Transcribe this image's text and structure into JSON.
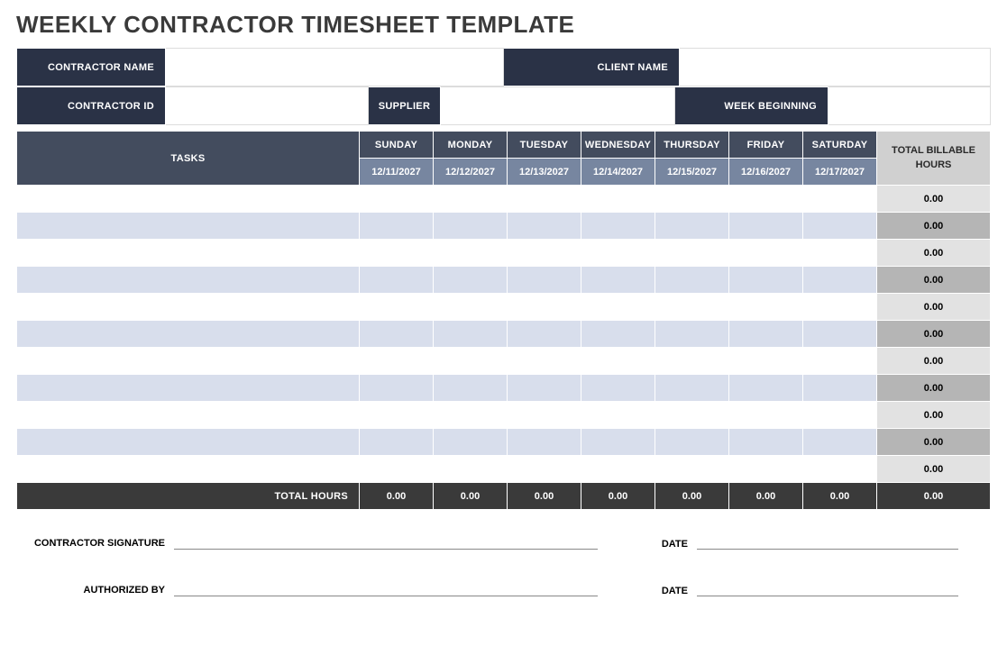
{
  "title": "WEEKLY CONTRACTOR TIMESHEET TEMPLATE",
  "meta": {
    "contractor_name_label": "CONTRACTOR NAME",
    "contractor_name": "",
    "client_name_label": "CLIENT NAME",
    "client_name": "",
    "contractor_id_label": "CONTRACTOR ID",
    "contractor_id": "",
    "supplier_label": "SUPPLIER",
    "supplier": "",
    "week_beginning_label": "WEEK BEGINNING",
    "week_beginning": ""
  },
  "headers": {
    "tasks": "TASKS",
    "total_billable": "TOTAL BILLABLE HOURS",
    "total_hours": "TOTAL HOURS"
  },
  "days": [
    {
      "name": "SUNDAY",
      "date": "12/11/2027"
    },
    {
      "name": "MONDAY",
      "date": "12/12/2027"
    },
    {
      "name": "TUESDAY",
      "date": "12/13/2027"
    },
    {
      "name": "WEDNESDAY",
      "date": "12/14/2027"
    },
    {
      "name": "THURSDAY",
      "date": "12/15/2027"
    },
    {
      "name": "FRIDAY",
      "date": "12/16/2027"
    },
    {
      "name": "SATURDAY",
      "date": "12/17/2027"
    }
  ],
  "rows": [
    {
      "task": "",
      "h": [
        "",
        "",
        "",
        "",
        "",
        "",
        ""
      ],
      "total": "0.00"
    },
    {
      "task": "",
      "h": [
        "",
        "",
        "",
        "",
        "",
        "",
        ""
      ],
      "total": "0.00"
    },
    {
      "task": "",
      "h": [
        "",
        "",
        "",
        "",
        "",
        "",
        ""
      ],
      "total": "0.00"
    },
    {
      "task": "",
      "h": [
        "",
        "",
        "",
        "",
        "",
        "",
        ""
      ],
      "total": "0.00"
    },
    {
      "task": "",
      "h": [
        "",
        "",
        "",
        "",
        "",
        "",
        ""
      ],
      "total": "0.00"
    },
    {
      "task": "",
      "h": [
        "",
        "",
        "",
        "",
        "",
        "",
        ""
      ],
      "total": "0.00"
    },
    {
      "task": "",
      "h": [
        "",
        "",
        "",
        "",
        "",
        "",
        ""
      ],
      "total": "0.00"
    },
    {
      "task": "",
      "h": [
        "",
        "",
        "",
        "",
        "",
        "",
        ""
      ],
      "total": "0.00"
    },
    {
      "task": "",
      "h": [
        "",
        "",
        "",
        "",
        "",
        "",
        ""
      ],
      "total": "0.00"
    },
    {
      "task": "",
      "h": [
        "",
        "",
        "",
        "",
        "",
        "",
        ""
      ],
      "total": "0.00"
    },
    {
      "task": "",
      "h": [
        "",
        "",
        "",
        "",
        "",
        "",
        ""
      ],
      "total": "0.00"
    }
  ],
  "totals": {
    "days": [
      "0.00",
      "0.00",
      "0.00",
      "0.00",
      "0.00",
      "0.00",
      "0.00"
    ],
    "grand": "0.00"
  },
  "signatures": {
    "contractor_label": "CONTRACTOR SIGNATURE",
    "contractor_date_label": "DATE",
    "authorized_label": "AUTHORIZED BY",
    "authorized_date_label": "DATE"
  }
}
